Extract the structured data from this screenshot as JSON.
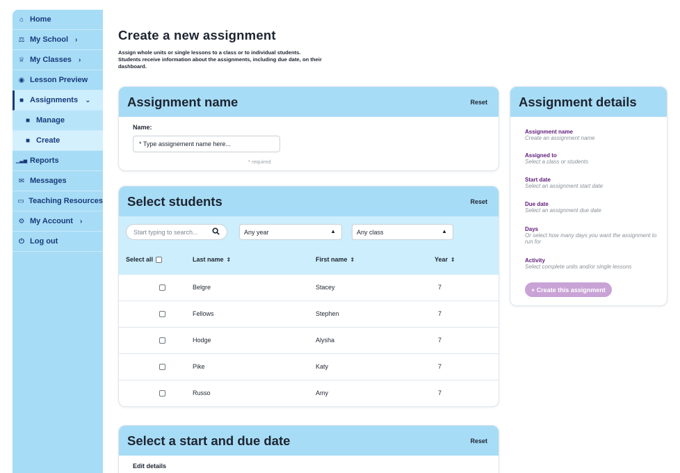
{
  "sidebar": {
    "items": [
      {
        "label": "Home",
        "icon": "home-icon",
        "glyph": "⌂"
      },
      {
        "label": "My School",
        "icon": "school-icon",
        "glyph": "⚖",
        "chevron": "›"
      },
      {
        "label": "My Classes",
        "icon": "graduation-cap-icon",
        "glyph": "♕",
        "chevron": "›"
      },
      {
        "label": "Lesson Preview",
        "icon": "eye-icon",
        "glyph": "◉"
      },
      {
        "label": "Assignments",
        "icon": "book-icon",
        "glyph": "■",
        "chevron": "⌄"
      },
      {
        "label": "Manage",
        "icon": "book-icon",
        "glyph": "■"
      },
      {
        "label": "Create",
        "icon": "file-icon",
        "glyph": "■"
      },
      {
        "label": "Reports",
        "icon": "bar-chart-icon",
        "glyph": "▁▃▅"
      },
      {
        "label": "Messages",
        "icon": "inbox-icon",
        "glyph": "✉"
      },
      {
        "label": "Teaching Resources",
        "icon": "folder-icon",
        "glyph": "▭"
      },
      {
        "label": "My Account",
        "icon": "gears-icon",
        "glyph": "⚙",
        "chevron": "›"
      },
      {
        "label": "Log out",
        "icon": "power-icon",
        "glyph": "⏻"
      }
    ]
  },
  "header": {
    "title": "Create a new assignment",
    "desc_line1": "Assign whole units or single lessons to a class or to individual students.",
    "desc_line2": "Students receive information about the assignments, including due date, on their dashboard."
  },
  "name_card": {
    "title": "Assignment name",
    "reset": "Reset",
    "field_label": "Name:",
    "placeholder": "* Type assignement name here...",
    "required": "* required"
  },
  "students_card": {
    "title": "Select students",
    "reset": "Reset",
    "search_placeholder": "Start typing to search...",
    "year_select": "Any year",
    "class_select": "Any class",
    "columns": {
      "select_all": "Select all",
      "last_name": "Last name",
      "first_name": "First name",
      "year": "Year"
    },
    "rows": [
      {
        "last": "Belgre",
        "first": "Stacey",
        "year": "7"
      },
      {
        "last": "Fellows",
        "first": "Stephen",
        "year": "7"
      },
      {
        "last": "Hodge",
        "first": "Alysha",
        "year": "7"
      },
      {
        "last": "Pike",
        "first": "Katy",
        "year": "7"
      },
      {
        "last": "Russo",
        "first": "Amy",
        "year": "7"
      }
    ]
  },
  "date_card": {
    "title": "Select a start and due date",
    "reset": "Reset",
    "edit": "Edit details"
  },
  "details_card": {
    "title": "Assignment details",
    "items": [
      {
        "title": "Assignment name",
        "hint": "Create an assignment name"
      },
      {
        "title": "Assigned to",
        "hint": "Select a class or students"
      },
      {
        "title": "Start date",
        "hint": "Select an assignment start date"
      },
      {
        "title": "Due date",
        "hint": "Select an assignment due date"
      },
      {
        "title": "Days",
        "hint": "Or select how many days you want the assignment to run for"
      },
      {
        "title": "Activity",
        "hint": "Select complete units and/or single lessons"
      }
    ],
    "button": "+ Create this assignment"
  },
  "colors": {
    "accent": "#a7dcf6",
    "accent_light": "#cdeefc",
    "nav_text": "#173a7a",
    "detail_title": "#5f1a7a",
    "button": "#c9a2d6"
  }
}
